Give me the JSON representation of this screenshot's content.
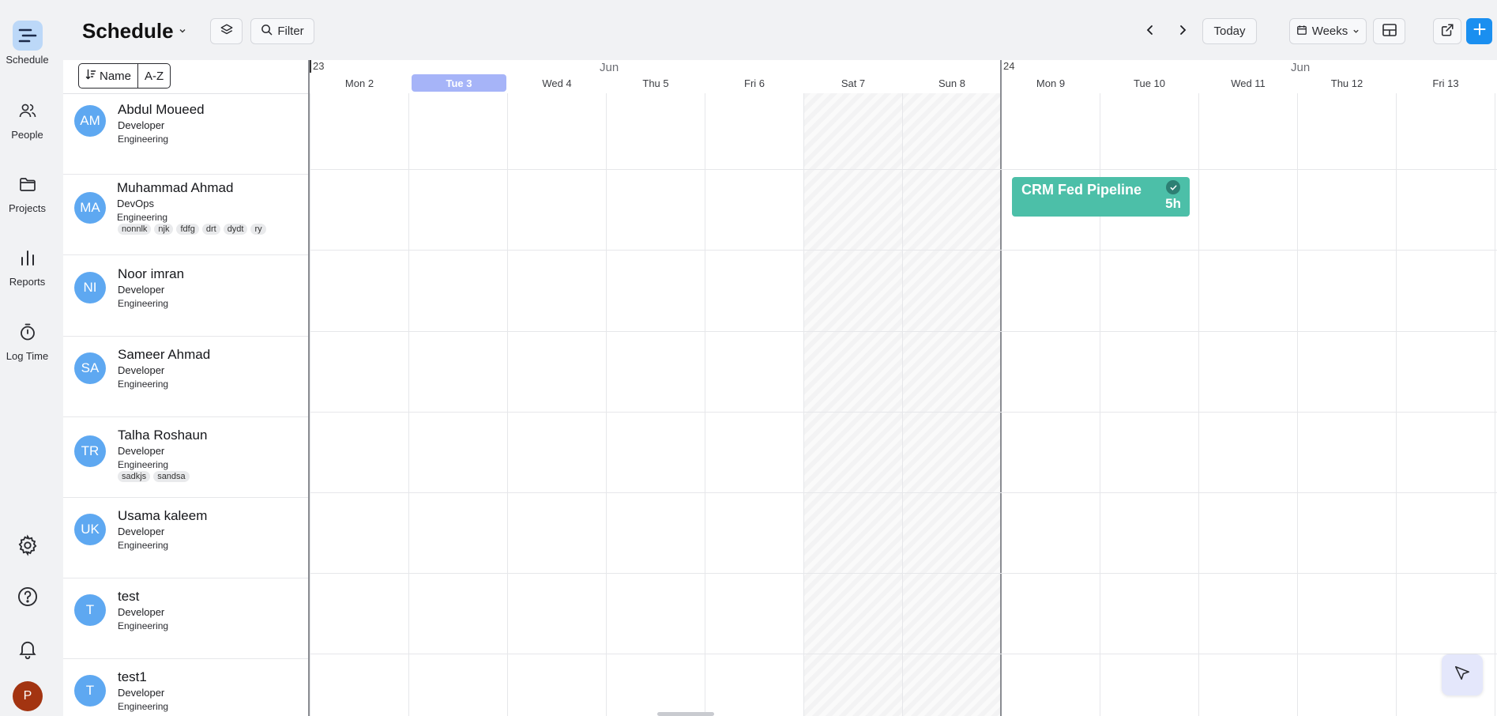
{
  "nav": {
    "items": [
      {
        "label": "Schedule",
        "icon": "schedule-icon"
      },
      {
        "label": "People",
        "icon": "people-icon"
      },
      {
        "label": "Projects",
        "icon": "folder-icon"
      },
      {
        "label": "Reports",
        "icon": "bar-chart-icon"
      },
      {
        "label": "Log Time",
        "icon": "stopwatch-icon"
      }
    ],
    "bottom_icons": [
      "settings-icon",
      "help-icon",
      "bell-icon"
    ],
    "avatar_initial": "P"
  },
  "toolbar": {
    "title": "Schedule",
    "filter_label": "Filter",
    "today_label": "Today",
    "view_label": "Weeks"
  },
  "sort": {
    "field_label": "Name",
    "order_label": "A-Z"
  },
  "calendar": {
    "weeks": [
      {
        "number": "23",
        "month": "Jun"
      },
      {
        "number": "24",
        "month": "Jun"
      }
    ],
    "days": [
      "Mon 2",
      "Tue 3",
      "Wed 4",
      "Thu 5",
      "Fri 6",
      "Sat 7",
      "Sun 8",
      "Mon 9",
      "Tue 10",
      "Wed 11",
      "Thu 12",
      "Fri 13"
    ],
    "today": "Tue 3",
    "weekend_days": [
      "Sat 7",
      "Sun 8"
    ]
  },
  "people": [
    {
      "initials": "AM",
      "name": "Abdul Moueed",
      "role": "Developer",
      "department": "Engineering",
      "tags": []
    },
    {
      "initials": "MA",
      "name": "Muhammad Ahmad",
      "role": "DevOps",
      "department": "Engineering",
      "tags": [
        "nonnlk",
        "njk",
        "fdfg",
        "drt",
        "dydt",
        "ry"
      ]
    },
    {
      "initials": "NI",
      "name": "Noor imran",
      "role": "Developer",
      "department": "Engineering",
      "tags": []
    },
    {
      "initials": "SA",
      "name": "Sameer Ahmad",
      "role": "Developer",
      "department": "Engineering",
      "tags": []
    },
    {
      "initials": "TR",
      "name": "Talha Roshaun",
      "role": "Developer",
      "department": "Engineering",
      "tags": [
        "sadkjs",
        "sandsa"
      ]
    },
    {
      "initials": "UK",
      "name": "Usama kaleem",
      "role": "Developer",
      "department": "Engineering",
      "tags": []
    },
    {
      "initials": "T",
      "name": "test",
      "role": "Developer",
      "department": "Engineering",
      "tags": []
    },
    {
      "initials": "T",
      "name": "test1",
      "role": "Developer",
      "department": "Engineering",
      "tags": []
    }
  ],
  "tasks": [
    {
      "name": "CRM Fed Pipeline",
      "hours": "5h",
      "person": "Muhammad Ahmad",
      "days": [
        "Mon 9",
        "Tue 10"
      ],
      "color": "#4cbfa8",
      "completed": true
    }
  ],
  "colors": {
    "accent": "#1a8ff0",
    "today_header": "#a6b4f8",
    "avatar": "#5ea8f1",
    "task": "#4cbfa8",
    "user_avatar": "#a33411"
  }
}
